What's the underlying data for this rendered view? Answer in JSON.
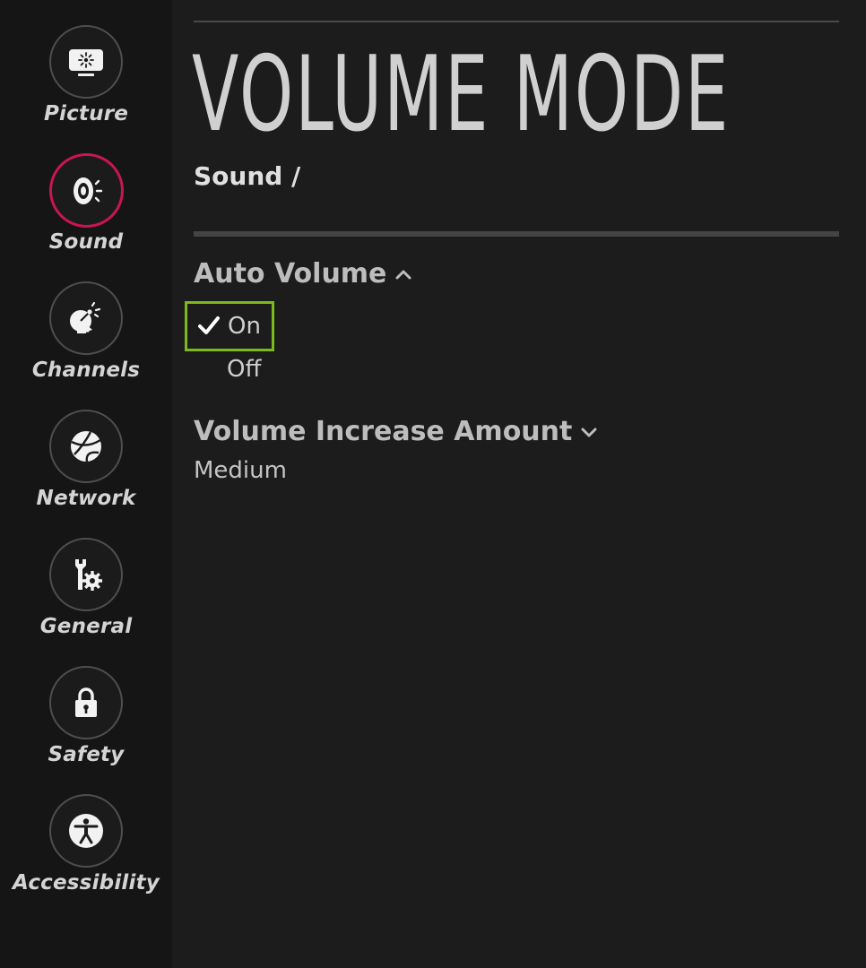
{
  "sidebar": {
    "items": [
      {
        "label": "Picture",
        "icon": "picture-icon",
        "active": false
      },
      {
        "label": "Sound",
        "icon": "sound-icon",
        "active": true
      },
      {
        "label": "Channels",
        "icon": "channels-icon",
        "active": false
      },
      {
        "label": "Network",
        "icon": "network-icon",
        "active": false
      },
      {
        "label": "General",
        "icon": "general-icon",
        "active": false
      },
      {
        "label": "Safety",
        "icon": "lock-icon",
        "active": false
      },
      {
        "label": "Accessibility",
        "icon": "accessibility-icon",
        "active": false
      }
    ]
  },
  "main": {
    "title": "VOLUME MODE",
    "breadcrumb": "Sound /",
    "sections": [
      {
        "label": "Auto Volume",
        "expanded": true,
        "options": [
          {
            "label": "On",
            "selected": true,
            "focused": true
          },
          {
            "label": "Off",
            "selected": false,
            "focused": false
          }
        ]
      },
      {
        "label": "Volume Increase Amount",
        "expanded": false,
        "value": "Medium"
      }
    ]
  },
  "colors": {
    "background": "#1c1c1c",
    "sidebar": "#151515",
    "active_ring": "#c8164f",
    "focus_outline": "#7cba1a",
    "text": "#d0d0d0"
  }
}
